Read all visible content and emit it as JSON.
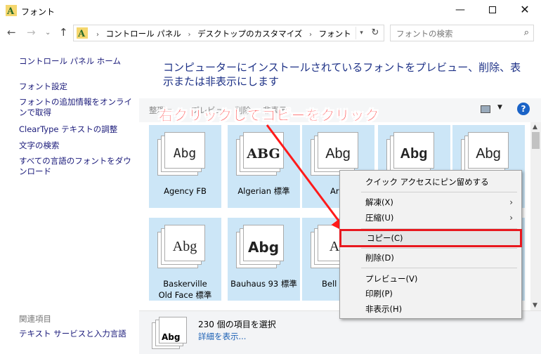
{
  "window": {
    "title": "フォント",
    "minimize": "—",
    "close": "✕"
  },
  "nav": {
    "back": "←",
    "forward": "→",
    "history": "⌄",
    "up": "↑",
    "breadcrumbs": [
      "コントロール パネル",
      "デスクトップのカスタマイズ",
      "フォント"
    ],
    "breadcrumb_sep": "›",
    "refresh": "↻",
    "search_placeholder": "フォントの検索"
  },
  "sidebar": {
    "home": "コントロール パネル ホーム",
    "links": [
      "フォント設定",
      "フォントの追加情報をオンラインで取得",
      "ClearType テキストの調整",
      "文字の検索",
      "すべての言語のフォントをダウンロード"
    ],
    "related_heading": "関連項目",
    "related_link": "テキスト サービスと入力言語"
  },
  "main": {
    "heading": "コンピューターにインストールされているフォントをプレビュー、削除、表示または非表示にします"
  },
  "commandbar": {
    "items": [
      "整理 ▾",
      "プレビュー",
      "削除",
      "非表示"
    ],
    "help": "?"
  },
  "fonts": [
    {
      "sample": "Abg",
      "name": "Agency FB"
    },
    {
      "sample": "ABG",
      "name": "Algerian 標準"
    },
    {
      "sample": "Abg",
      "name": "Arial"
    },
    {
      "sample": "Abg",
      "name": ""
    },
    {
      "sample": "Abg",
      "name": ""
    },
    {
      "sample": "Abg",
      "name": "Baskerville Old Face 標準"
    },
    {
      "sample": "Abg",
      "name": "Bauhaus 93 標準"
    },
    {
      "sample": "Ab",
      "name": "Bell M"
    }
  ],
  "details": {
    "thumb_sample": "Abg",
    "count": "230 個の項目を選択",
    "more": "詳細を表示..."
  },
  "annotation": {
    "text": "右クリックしてコピーをクリック",
    "color": "#ff1a1a"
  },
  "context_menu": {
    "items": [
      {
        "label": "クイック アクセスにピン留めする"
      },
      {
        "label": "解凍(X)",
        "submenu": "›"
      },
      {
        "label": "圧縮(U)",
        "submenu": "›"
      },
      {
        "label": "コピー(C)",
        "highlighted": true
      },
      {
        "label": "削除(D)"
      },
      {
        "label": "プレビュー(V)"
      },
      {
        "label": "印刷(P)"
      },
      {
        "label": "非表示(H)"
      }
    ]
  }
}
